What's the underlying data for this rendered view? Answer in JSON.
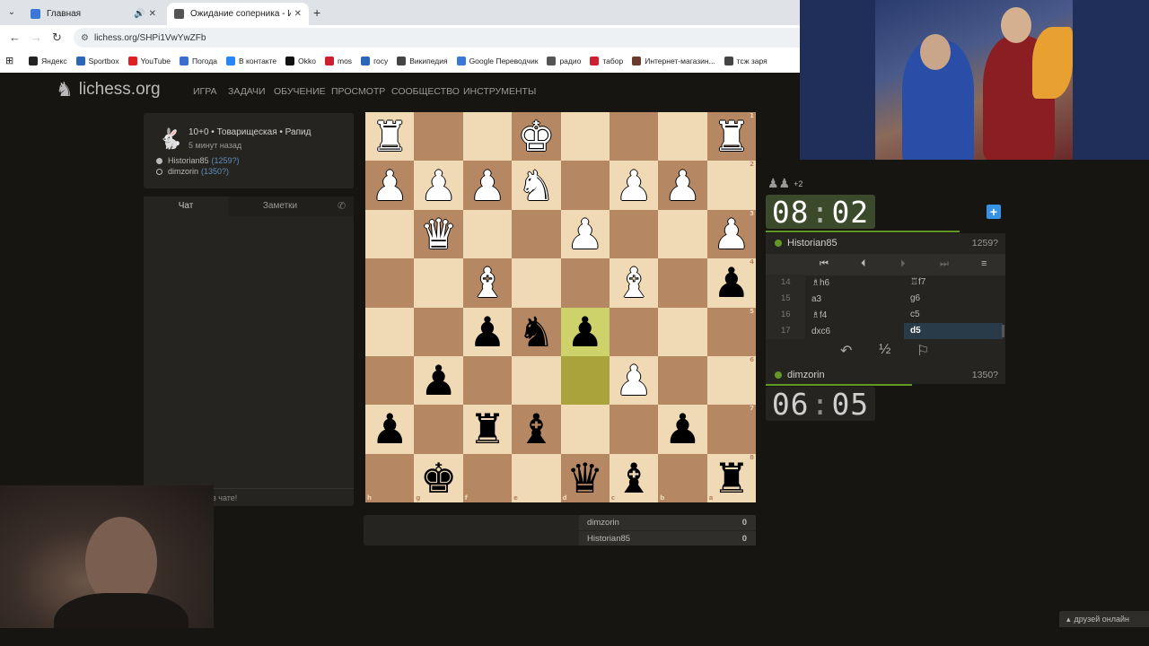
{
  "browser": {
    "tabs": [
      {
        "title": "Главная",
        "favicon_color": "#3a77d8"
      },
      {
        "title": "Ожидание соперника - Игра I",
        "favicon_color": "#555555"
      }
    ],
    "url": "lichess.org/SHPi1VwYwZFb",
    "bookmarks": [
      {
        "label": "Яндекс",
        "color": "#222222"
      },
      {
        "label": "Sportbox",
        "color": "#2b67b8"
      },
      {
        "label": "YouTube",
        "color": "#e02020"
      },
      {
        "label": "Погода",
        "color": "#3a6fd0"
      },
      {
        "label": "В контакте",
        "color": "#2787f5"
      },
      {
        "label": "Okko",
        "color": "#111111"
      },
      {
        "label": "mos",
        "color": "#cc2030"
      },
      {
        "label": "госу",
        "color": "#2b67b8"
      },
      {
        "label": "Википедия",
        "color": "#444444"
      },
      {
        "label": "Google Переводчик",
        "color": "#3a77d8"
      },
      {
        "label": "радио",
        "color": "#555555"
      },
      {
        "label": "табор",
        "color": "#cc2030"
      },
      {
        "label": "Интернет-магазин...",
        "color": "#6a3a2a"
      },
      {
        "label": "тсж заря",
        "color": "#444444"
      }
    ]
  },
  "site": {
    "logo": "lichess.org",
    "nav": [
      "ИГРА",
      "ЗАДАЧИ",
      "ОБУЧЕНИЕ",
      "ПРОСМОТР",
      "СООБЩЕСТВО",
      "ИНСТРУМЕНТЫ"
    ]
  },
  "game": {
    "setup": "10+0 • Товарищеская • Рапид",
    "time_ago": "5 минут назад",
    "players": [
      {
        "name": "Historian85",
        "rating": "(1259?)",
        "color": "white"
      },
      {
        "name": "dimzorin",
        "rating": "(1350?)",
        "color": "black"
      }
    ]
  },
  "chat": {
    "tab_chat": "Чат",
    "tab_notes": "Заметки",
    "input_placeholder": "в чате!"
  },
  "board": {
    "ranks": [
      "1",
      "2",
      "3",
      "4",
      "5",
      "6",
      "7",
      "8"
    ],
    "files": [
      "h",
      "g",
      "f",
      "e",
      "d",
      "c",
      "b",
      "a"
    ],
    "rows": [
      [
        "wr",
        "",
        "",
        "wk",
        "",
        "",
        "",
        "wr"
      ],
      [
        "wp",
        "wp",
        "wp",
        "wn",
        "",
        "wp",
        "wp",
        ""
      ],
      [
        "",
        "wq",
        "",
        "",
        "wp",
        "",
        "",
        "wp"
      ],
      [
        "",
        "",
        "wb",
        "",
        "",
        "wb",
        "",
        "bp"
      ],
      [
        "",
        "",
        "bp",
        "bn",
        "bp",
        "",
        "",
        ""
      ],
      [
        "",
        "bp",
        "",
        "",
        "",
        "wp",
        "",
        ""
      ],
      [
        "bp",
        "",
        "br",
        "bb",
        "",
        "",
        "bp",
        ""
      ],
      [
        "",
        "bk",
        "",
        "",
        "bq",
        "bb",
        "",
        "br"
      ]
    ],
    "highlight": [
      [
        4,
        4
      ],
      [
        5,
        4
      ]
    ]
  },
  "scores": [
    {
      "name": "dimzorin",
      "score": "0"
    },
    {
      "name": "Historian85",
      "score": "0"
    }
  ],
  "right": {
    "material_diff": "+2",
    "clock_top": {
      "min": "08",
      "sec": "02"
    },
    "clock_bottom": {
      "min": "06",
      "sec": "05"
    },
    "top_player": {
      "name": "Historian85",
      "rating": "1259?"
    },
    "bottom_player": {
      "name": "dimzorin",
      "rating": "1350?"
    },
    "moves": [
      {
        "no": "14",
        "white": "♗h6",
        "black": "♖f7"
      },
      {
        "no": "15",
        "white": "a3",
        "black": "g6"
      },
      {
        "no": "16",
        "white": "♗f4",
        "black": "c5"
      },
      {
        "no": "17",
        "white": "dxc6",
        "black": "d5"
      }
    ],
    "draw_label": "½"
  },
  "footer": {
    "friends": "друзей онлайн"
  }
}
